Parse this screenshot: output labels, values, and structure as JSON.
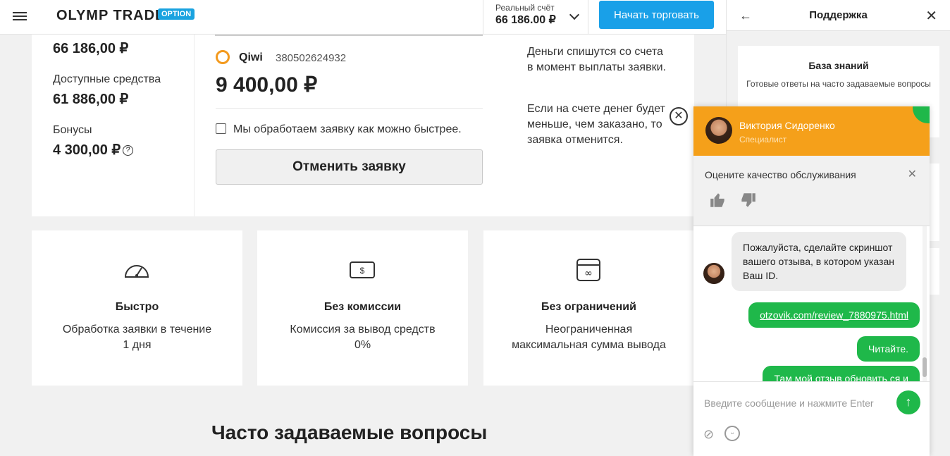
{
  "header": {
    "logo": "OLYMP TRADE",
    "logo_badge": "OPTION",
    "account_label": "Реальный счёт",
    "account_value": "66 186.00 ₽",
    "start_button": "Начать торговать"
  },
  "balances": {
    "total_value": "66 186,00 ₽",
    "available_label": "Доступные средства",
    "available_value": "61 886,00 ₽",
    "bonus_label": "Бонусы",
    "bonus_value": "4 300,00 ₽",
    "bonus_help": "?"
  },
  "withdrawal": {
    "method": "Qiwi",
    "number": "380502624932",
    "amount": "9 400,00 ₽",
    "note": "Мы обработаем заявку как можно быстрее.",
    "cancel_button": "Отменить заявку"
  },
  "info": {
    "text1": "Деньги спишутся со счета в момент выплаты заявки.",
    "text2": "Если на счете денег будет меньше, чем заказано, то заявка отменится."
  },
  "features": [
    {
      "title": "Быстро",
      "text": "Обработка заявки в течение 1 дня"
    },
    {
      "title": "Без комиссии",
      "text": "Комиссия за вывод средств 0%"
    },
    {
      "title": "Без ограничений",
      "text": "Неограниченная максимальная сумма вывода"
    }
  ],
  "faq_title": "Часто задаваемые вопросы",
  "sidebar": {
    "title": "Поддержка",
    "kb_title": "База знаний",
    "kb_text": "Готовые ответы на часто задаваемые вопросы"
  },
  "chat": {
    "agent_name": "Виктория Сидоренко",
    "agent_role": "Специалист",
    "rate_text": "Оцените качество обслуживания",
    "msg_in": "Пожалуйста, сделайте скриншот вашего отзыва, в котором указан Ваш ID.",
    "msg_link": "otzovik.com/review_7880975.html",
    "msg_read": "Читайте.",
    "msg_partial": "Там мой отзыв обновить ся и",
    "input_placeholder": "Введите сообщение и нажмите Enter"
  }
}
